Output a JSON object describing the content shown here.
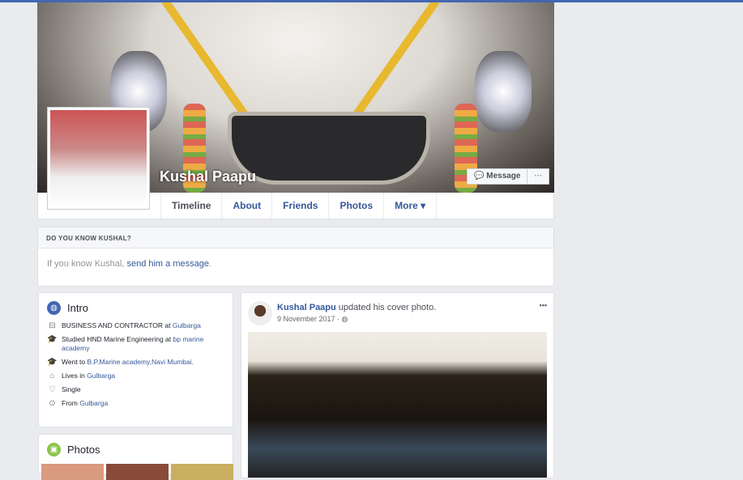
{
  "profile": {
    "name": "Kushal Paapu",
    "message_label": "Message",
    "more_label": "···"
  },
  "nav": {
    "tabs": [
      "Timeline",
      "About",
      "Friends",
      "Photos",
      "More ▾"
    ]
  },
  "know": {
    "title": "DO YOU KNOW KUSHAL?",
    "text": "If you know Kushal, ",
    "link": "send him a message",
    "end": "."
  },
  "intro": {
    "title": "Intro",
    "items": [
      {
        "icon": "briefcase-icon",
        "text": "BUSINESS AND CONTRACTOR at ",
        "link": "Gulbarga"
      },
      {
        "icon": "graduation-cap-icon",
        "text": "Studied HND Marine Engineering at ",
        "link": "bp marine academy"
      },
      {
        "icon": "graduation-cap-icon",
        "text": "Went to ",
        "link": "B.P.Marine academy,Navi Mumbai."
      },
      {
        "icon": "home-icon",
        "text": "Lives in ",
        "link": "Gulbarga"
      },
      {
        "icon": "heart-icon",
        "text": "Single",
        "link": ""
      },
      {
        "icon": "location-pin-icon",
        "text": "From ",
        "link": "Gulbarga"
      }
    ]
  },
  "photos": {
    "title": "Photos"
  },
  "post": {
    "author": "Kushal Paapu",
    "action": " updated his cover photo.",
    "date": "9 November 2017 · ",
    "menu": "•••"
  },
  "colors": {
    "brand": "#4267b2",
    "link": "#365899"
  }
}
